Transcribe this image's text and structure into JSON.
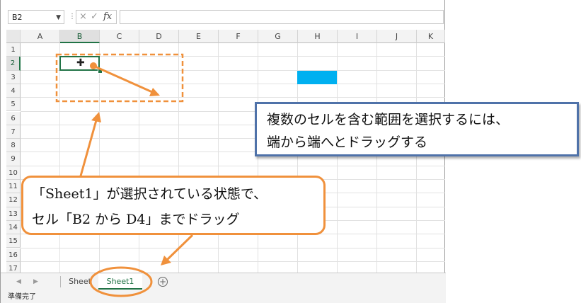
{
  "namebox": {
    "value": "B2"
  },
  "formula_bar": {
    "cancel_icon": "×",
    "enter_icon": "✓",
    "fx_label": "fx",
    "value": ""
  },
  "columns": [
    "A",
    "B",
    "C",
    "D",
    "E",
    "F",
    "G",
    "H",
    "I",
    "J",
    "K"
  ],
  "rows": [
    "1",
    "2",
    "3",
    "4",
    "5",
    "6",
    "7",
    "8",
    "9",
    "10",
    "11",
    "12",
    "13",
    "14",
    "15",
    "16",
    "17"
  ],
  "selection": {
    "active_cell": "B2",
    "selected_column": "B",
    "selected_row": "2"
  },
  "sheet_tabs": {
    "tabs": [
      "Sheet",
      "Sheet1"
    ],
    "active": "Sheet1",
    "add_icon": "+"
  },
  "status": {
    "text": "準備完了"
  },
  "colors": {
    "accent": "#217346",
    "highlight_cell": "#00b0f0",
    "annotation_orange": "#f0913c",
    "annotation_blue": "#4f72a9"
  },
  "callouts": {
    "blue_line1": "複数のセルを含む範囲を選択するには、",
    "blue_line2": "端から端へとドラッグする",
    "orange_line1": "「Sheet1」が選択されている状態で、",
    "orange_line2": "セル「B2 から D4」までドラッグ"
  }
}
